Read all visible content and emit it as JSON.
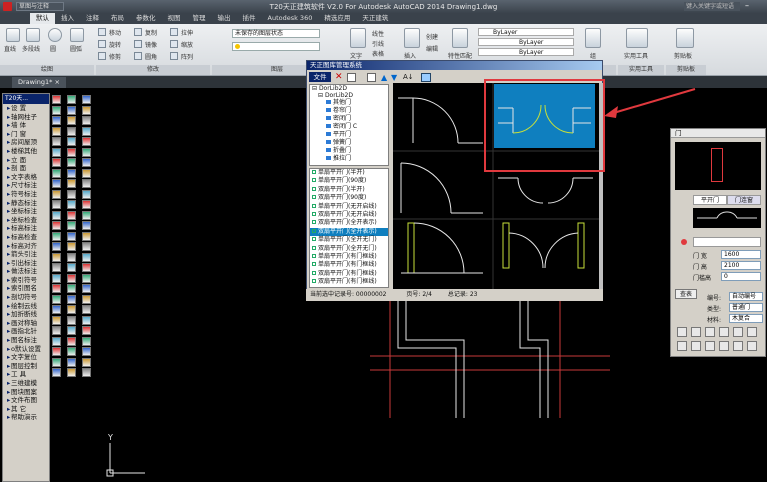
{
  "title_bar": {
    "title": "T20天正建筑软件 V2.0 For Autodesk AutoCAD 2014    Drawing1.dwg",
    "search_hint": "键入关键字或短语",
    "workspace": "草图与注释"
  },
  "ribbon_tabs": [
    "默认",
    "插入",
    "注释",
    "布局",
    "参数化",
    "视图",
    "管理",
    "输出",
    "插件",
    "Autodesk 360",
    "精选应用",
    "天正建筑"
  ],
  "ribbon": {
    "draw_tools": [
      "直线",
      "多段线",
      "圆",
      "圆弧"
    ],
    "modify_tools": [
      "移动",
      "旋转",
      "修剪",
      "复制",
      "镜像",
      "圆角",
      "拉伸",
      "缩放",
      "阵列"
    ],
    "layer_state": "未保存的图层状态",
    "text_label": "文字",
    "annotation_label": "注释",
    "annotation_items": [
      "线性",
      "引线",
      "表格"
    ],
    "insert_label": "插入",
    "block_items": [
      "创建",
      "编辑"
    ],
    "properties_label": "特性匹配",
    "bylayer": [
      "ByLayer",
      "ByLayer",
      "ByLayer"
    ],
    "group_label": "组",
    "utilities_label": "实用工具",
    "clipboard_label": "剪贴板",
    "group_labels": [
      "绘图",
      "修改",
      "图层",
      "注释",
      "块",
      "特性",
      "组",
      "实用工具",
      "剪贴板"
    ]
  },
  "file_tab": "Drawing1*",
  "tianzheng_panel": {
    "header": "T20天...",
    "items": [
      "设 置",
      "轴网柱子",
      "墙 体",
      "门 窗",
      "房间屋顶",
      "楼梯其他",
      "立 面",
      "剖 面",
      "文字表格",
      "尺寸标注",
      "符号标注",
      "静态标注",
      "坐标标注",
      "坐标检查",
      "标高标注",
      "标高检查",
      "标高对齐",
      "箭头引注",
      "引出标注",
      "做法标注",
      "索引符号",
      "索引图名",
      "剖切符号",
      "绘制云线",
      "加折断线",
      "画对称轴",
      "画指北针",
      "图名标注",
      "o默认设置",
      "文字复位",
      "图层控制",
      "工 具",
      "三维建模",
      "图块图案",
      "文件布图",
      "其 它",
      "帮助演示"
    ]
  },
  "dialog": {
    "title": "天正图库管理系统",
    "menu": [
      "文件"
    ],
    "tree_root": "DorLib2D",
    "tree_child": "DorLib2D",
    "tree_items": [
      "其他门",
      "卷帘门",
      "密闭门",
      "密闭门 C",
      "平开门",
      "弹簧门",
      "折叠门",
      "推拉门"
    ],
    "list_items": [
      "单扇平开门(半开)",
      "单扇平开门(90度)",
      "双扇平开门(半开)",
      "双扇平开门(90度)",
      "单扇平开门(无开启线)",
      "双扇平开门(无开启线)",
      "双扇平开门(全开表示)",
      "双扇平开门(全开表示)",
      "单扇平开门(全开无门)",
      "双扇平开门(全开无门)",
      "单扇平开门(有门框线)",
      "单扇平开门(有门框线)",
      "双扇平开门(有门框线)",
      "双扇平开门(有门框线)"
    ],
    "selected_index": 7,
    "status_record": "当前选中记录号: 00000002",
    "status_page": "页号: 2/4",
    "status_total": "总记录: 23"
  },
  "door_panel": {
    "title": "门",
    "tabs": [
      "平开门",
      "门连窗"
    ],
    "width_label": "门 宽",
    "width": "1600",
    "height_label": "门 高",
    "height": "2100",
    "sill_label": "门槛高",
    "sill": "0",
    "lookup_button": "查表",
    "number_label": "编号:",
    "number_value": "自动编号",
    "type_label": "类型:",
    "type_value": "普通门",
    "material_label": "材料:",
    "material_value": "木复合"
  },
  "ucs": {
    "y_label": "Y"
  },
  "colors": {
    "canvas": "#000000",
    "selection_blue": "#0f7fbf",
    "highlight_red": "#e0393e",
    "drawing_red": "#c83a3a",
    "cad_line_white": "#e6e6e6"
  }
}
